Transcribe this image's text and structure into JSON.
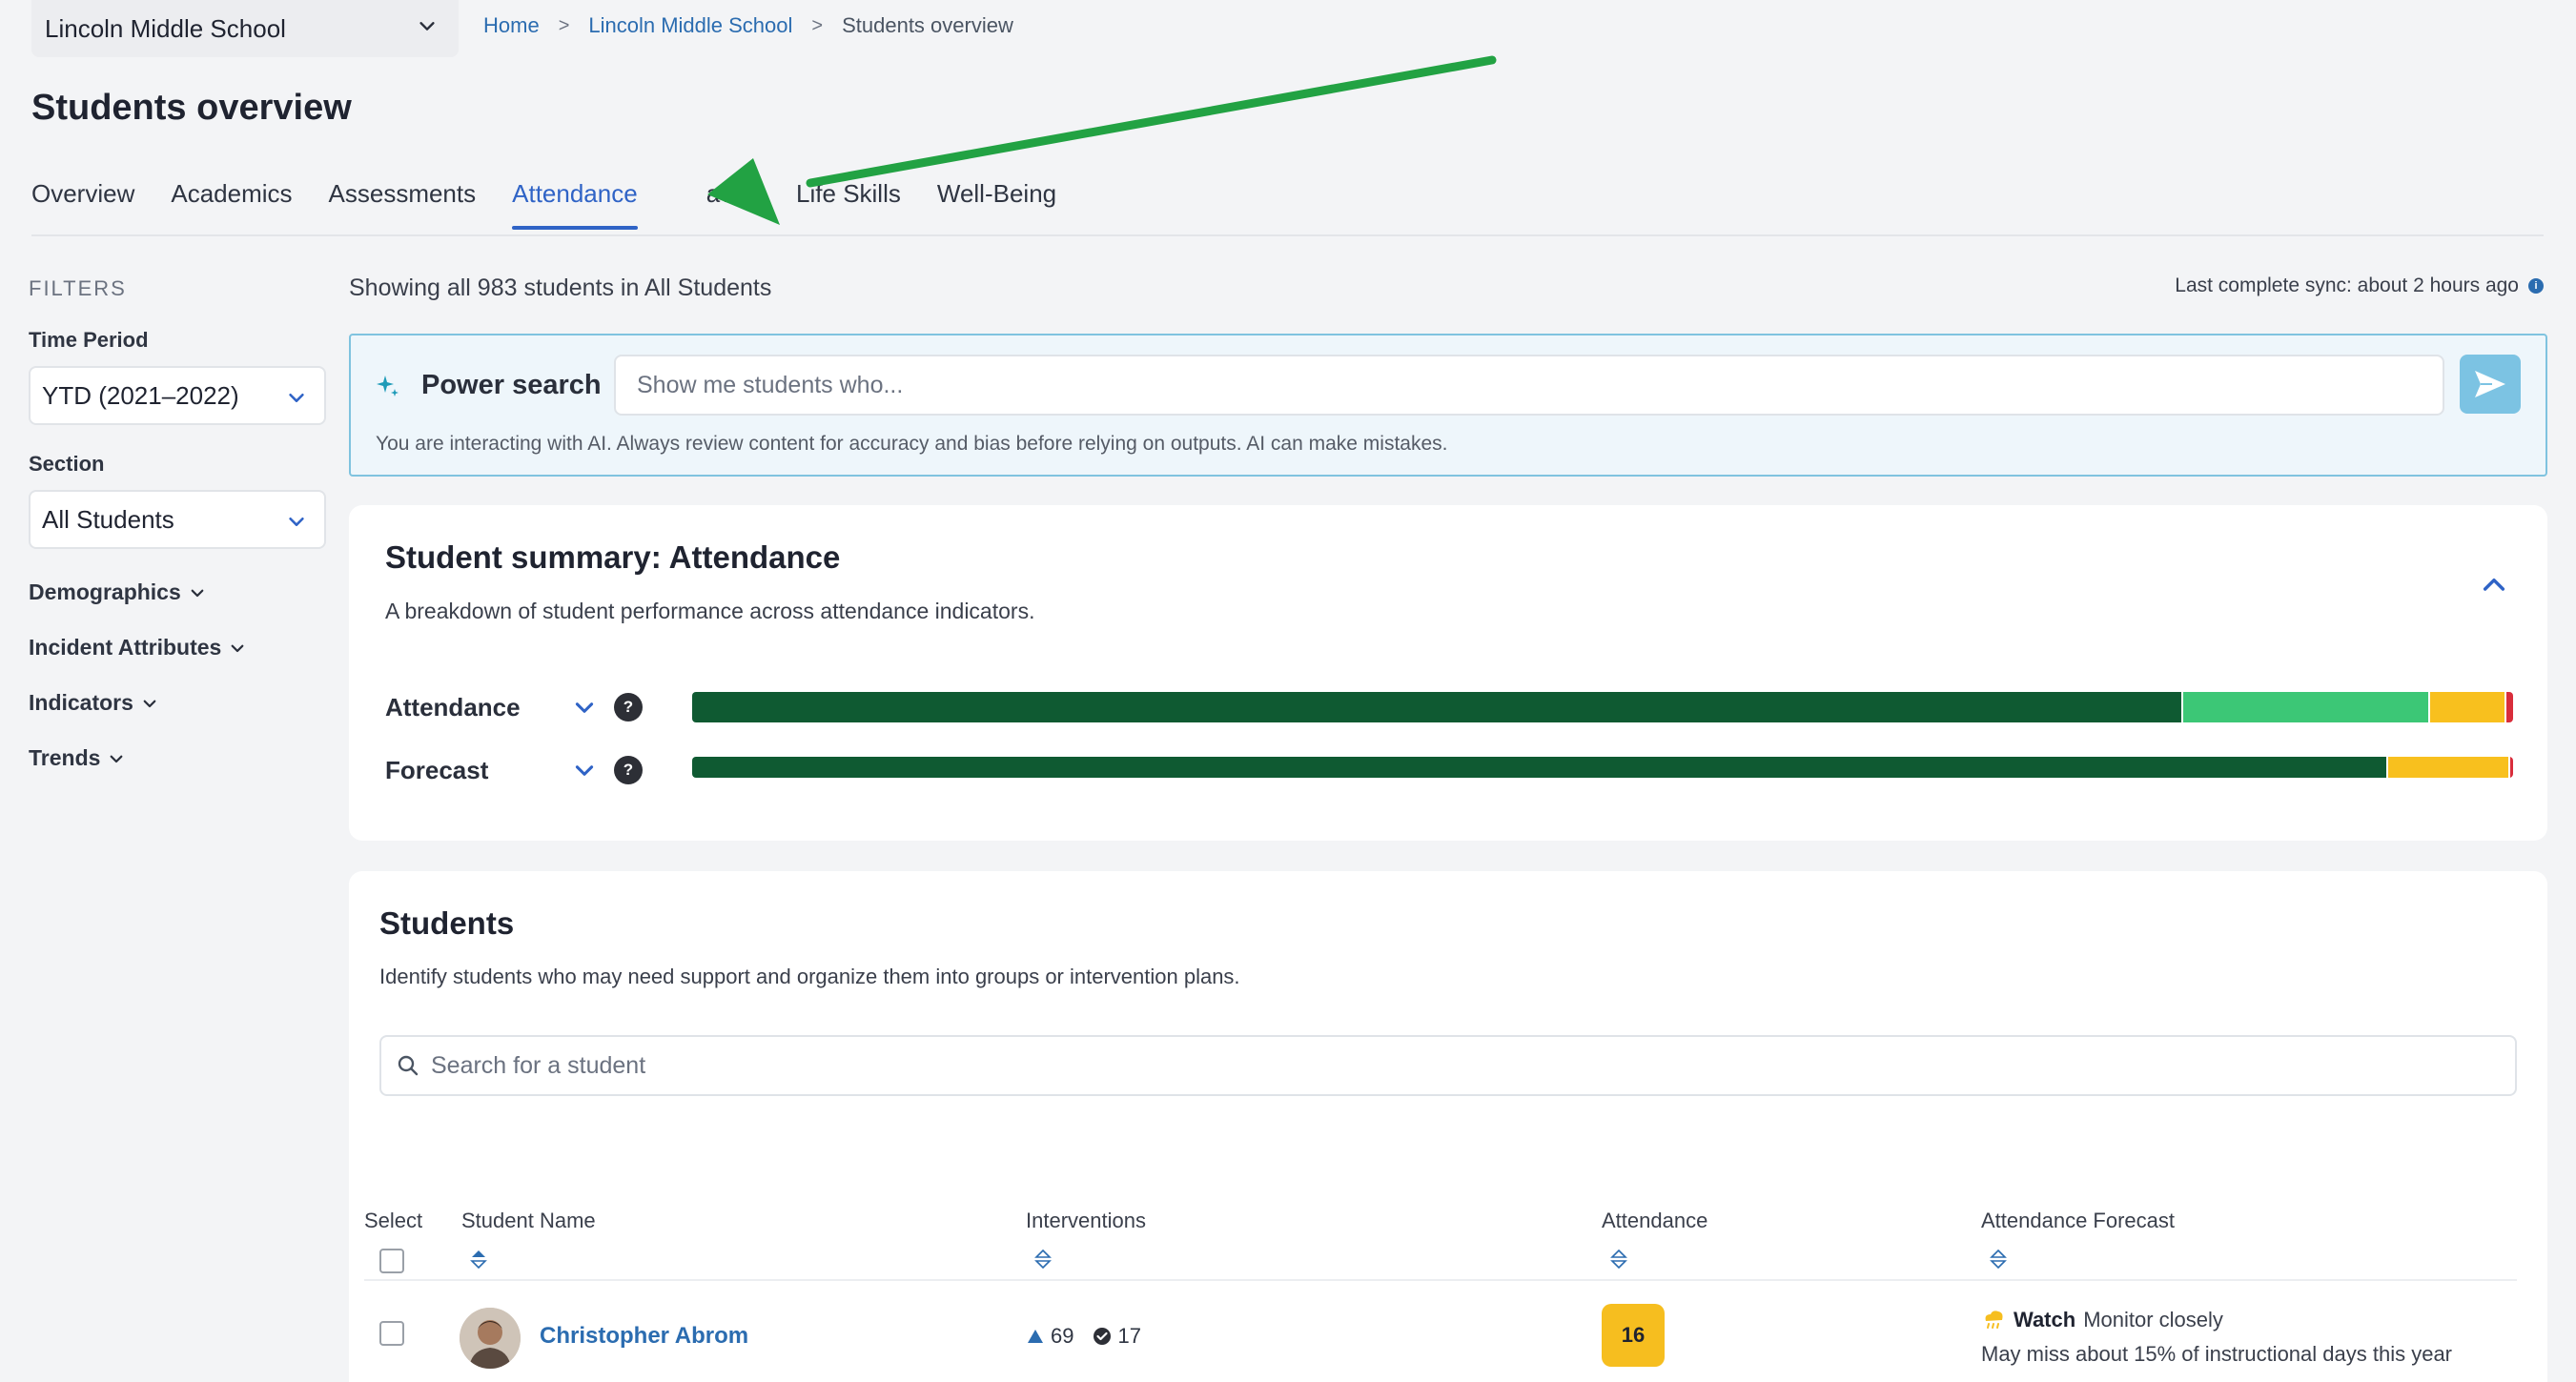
{
  "header": {
    "school": "Lincoln Middle School",
    "breadcrumb": [
      {
        "label": "Home"
      },
      {
        "label": "Lincoln Middle School"
      },
      {
        "label": "Students overview"
      }
    ],
    "breadcrumb_separator": ">",
    "page_title": "Students overview"
  },
  "tabs": [
    {
      "label": "Overview",
      "active": false
    },
    {
      "label": "Academics",
      "active": false
    },
    {
      "label": "Assessments",
      "active": false
    },
    {
      "label": "Attendance",
      "active": true
    },
    {
      "label": "avior",
      "active": false
    },
    {
      "label": "Life Skills",
      "active": false
    },
    {
      "label": "Well-Being",
      "active": false
    }
  ],
  "sidebar": {
    "heading": "FILTERS",
    "time_period_label": "Time Period",
    "time_period_value": "YTD (2021–2022)",
    "section_label": "Section",
    "section_value": "All Students",
    "toggles": [
      "Demographics",
      "Incident Attributes",
      "Indicators",
      "Trends"
    ]
  },
  "main": {
    "showing": "Showing all 983 students in All Students",
    "sync": "Last complete sync: about 2 hours ago",
    "sync_info_icon": "info-icon"
  },
  "power_search": {
    "label": "Power search",
    "placeholder": "Show me students who...",
    "disclaimer": "You are interacting with AI. Always review content for accuracy and bias before relying on outputs. AI can make mistakes.",
    "send_icon": "send-icon",
    "accent": "#7cc3e3"
  },
  "summary": {
    "title": "Student summary: Attendance",
    "subtitle": "A breakdown of student performance across attendance indicators.",
    "help_glyph": "?",
    "indicators": [
      {
        "name": "Attendance",
        "segments": [
          {
            "color": "#0f5a32",
            "fraction": 0.8572
          },
          {
            "color": "#3cc776",
            "fraction": 0.1422
          },
          {
            "color": "#f8c01e",
            "fraction": 0.0434
          },
          {
            "color": "#d92d3b",
            "fraction": 0.0052
          }
        ]
      },
      {
        "name": "Forecast",
        "segments": [
          {
            "color": "#0f5a32",
            "fraction": 0.9774
          },
          {
            "color": "#f8c01e",
            "fraction": 0.0707
          },
          {
            "color": "#d92d3b",
            "fraction": 0.0026
          }
        ]
      }
    ]
  },
  "students": {
    "title": "Students",
    "subtitle": "Identify students who may need support and organize them into groups or intervention plans.",
    "search_placeholder": "Search for a student",
    "columns": [
      "Select",
      "Student Name",
      "Interventions",
      "Attendance",
      "Attendance Forecast"
    ],
    "rows": [
      {
        "name": "Christopher Abrom",
        "interventions_open": "69",
        "interventions_closed": "17",
        "attendance": "16",
        "forecast_status": "Watch",
        "forecast_action": "Monitor closely",
        "forecast_detail": "May miss about 15% of instructional days this year"
      }
    ]
  },
  "colors": {
    "brand_blue": "#2f63c6",
    "link_blue": "#2b6cb0",
    "annotation_arrow": "#22a243",
    "badge_yellow": "#f6be1f"
  }
}
